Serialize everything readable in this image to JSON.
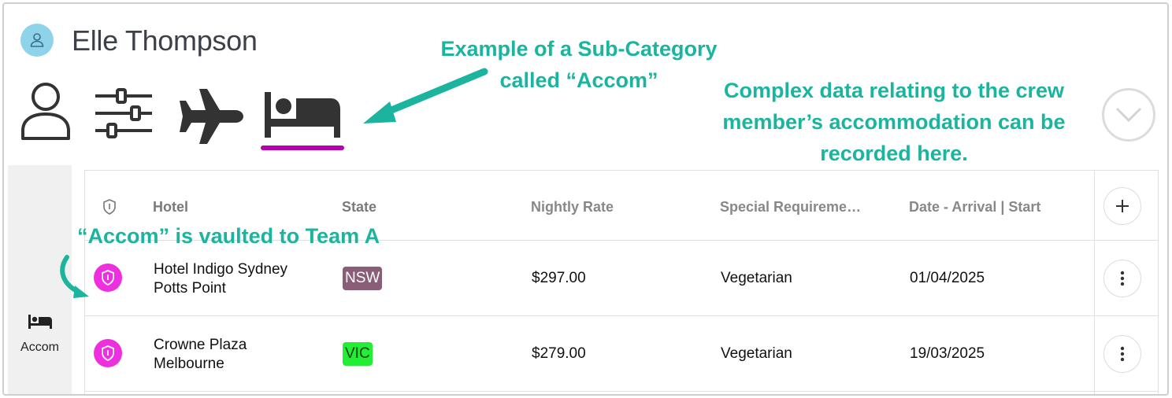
{
  "user": {
    "name": "Elle Thompson"
  },
  "tabs": [
    {
      "icon": "person-icon",
      "label": ""
    },
    {
      "icon": "sliders-icon",
      "label": ""
    },
    {
      "icon": "airplane-icon",
      "label": ""
    },
    {
      "icon": "bed-icon",
      "label": "",
      "active": true
    }
  ],
  "annotations": {
    "subcategory": "Example of a Sub-Category called “Accom”",
    "complex_data": "Complex data relating to the crew member’s accommodation can be recorded here.",
    "vaulted": "“Accom” is vaulted to Team A"
  },
  "sidebar": {
    "items": [
      {
        "icon": "bed-icon",
        "label": "Accom"
      }
    ]
  },
  "table": {
    "columns": [
      "Hotel",
      "State",
      "Nightly Rate",
      "Special Requireme…",
      "Date - Arrival | Start"
    ],
    "rows": [
      {
        "hotel_line1": "Hotel Indigo Sydney",
        "hotel_line2": "Potts Point",
        "state": "NSW",
        "rate": "$297.00",
        "special": "Vegetarian",
        "date": "01/04/2025"
      },
      {
        "hotel_line1": "Crowne Plaza",
        "hotel_line2": "Melbourne",
        "state": "VIC",
        "rate": "$279.00",
        "special": "Vegetarian",
        "date": "19/03/2025"
      }
    ]
  },
  "colors": {
    "accent_annotation": "#1bb59f",
    "tab_active_underline": "#b300b0",
    "vault_shield": "#ee2fe0",
    "badge_nsw": "#8a5d78",
    "badge_vic": "#22ee33"
  }
}
